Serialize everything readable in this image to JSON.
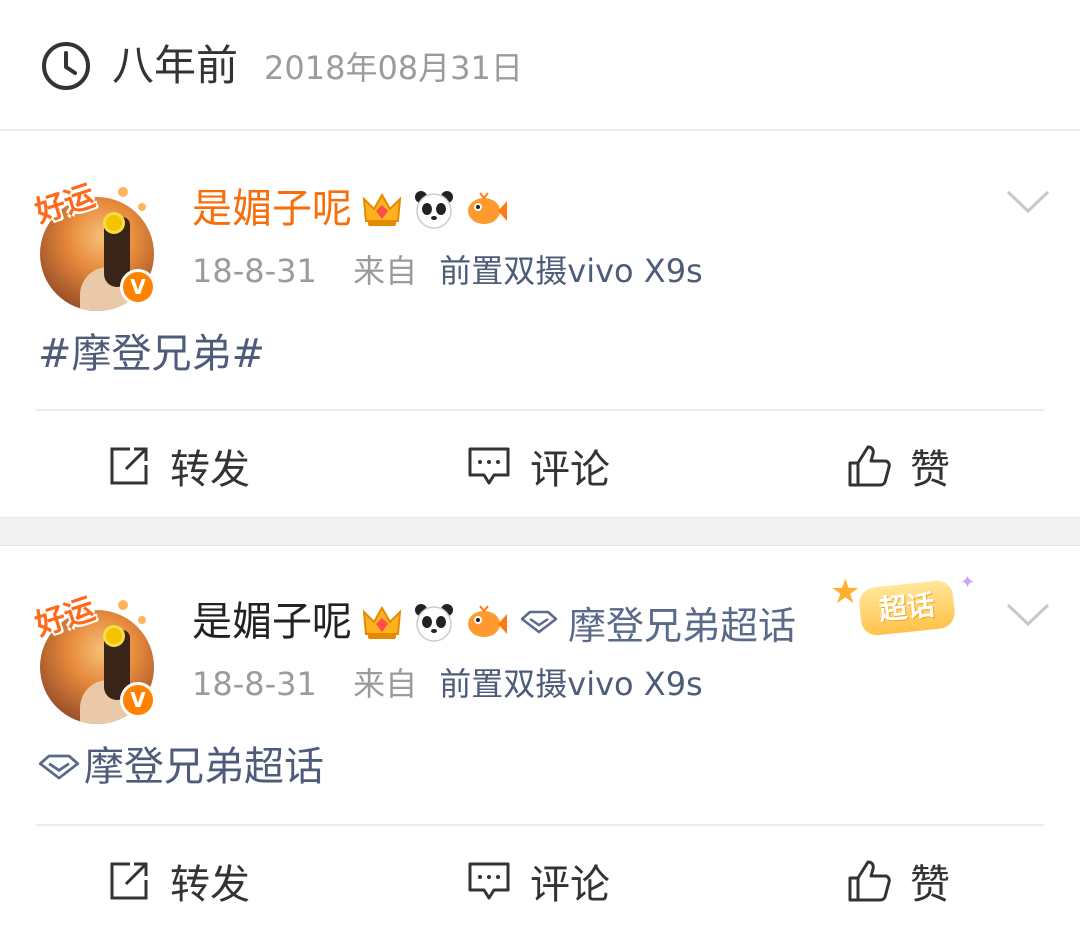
{
  "header": {
    "relative_time": "八年前",
    "date": "2018年08月31日",
    "icon": "clock-icon"
  },
  "posts": [
    {
      "avatar_overlay": "好运",
      "verified_badge": "V",
      "author": "是媚子呢",
      "author_color": "#f86e0b",
      "badges": [
        "crown-icon",
        "panda-icon",
        "fish-icon"
      ],
      "topic_inline": "",
      "time": "18-8-31",
      "from_label": "来自",
      "device": "前置双摄vivo X9s",
      "content": "#摩登兄弟#",
      "actions": {
        "repost": "转发",
        "comment": "评论",
        "like": "赞"
      }
    },
    {
      "avatar_overlay": "好运",
      "verified_badge": "V",
      "author": "是媚子呢",
      "author_color": "#222222",
      "badges": [
        "crown-icon",
        "panda-icon",
        "fish-icon"
      ],
      "topic_inline": "摩登兄弟超话",
      "supertag": "超话",
      "time": "18-8-31",
      "from_label": "来自",
      "device": "前置双摄vivo X9s",
      "content": "摩登兄弟超话",
      "actions": {
        "repost": "转发",
        "comment": "评论",
        "like": "赞"
      }
    }
  ],
  "colors": {
    "link": "#4e5c7a",
    "muted": "#9b9b9b",
    "accent": "#ff8200"
  }
}
